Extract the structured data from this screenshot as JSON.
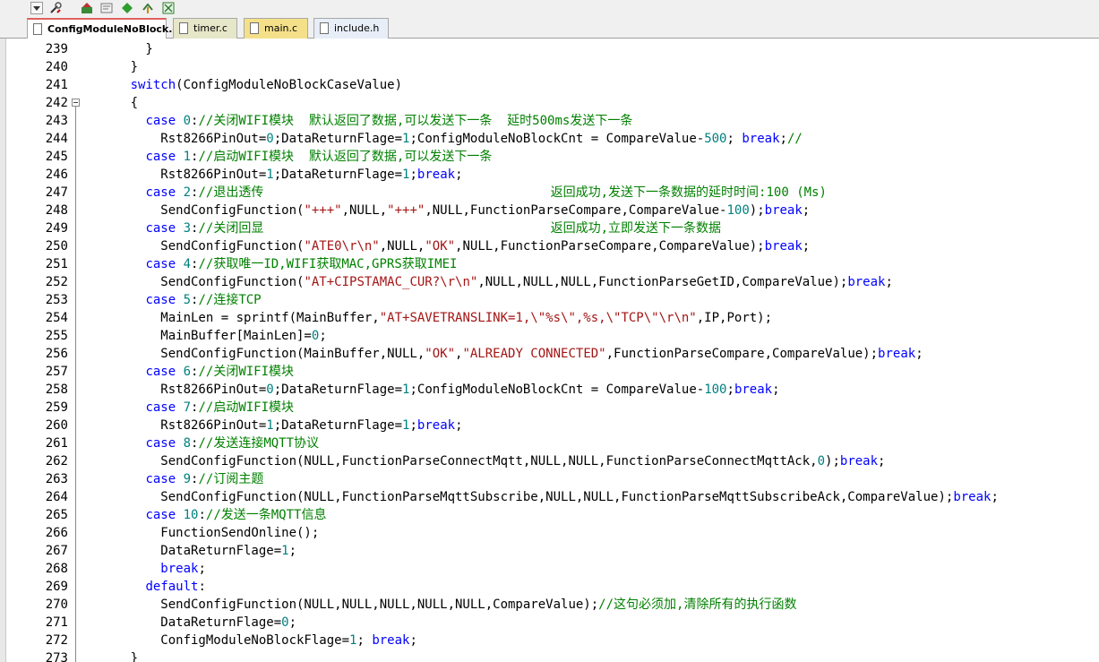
{
  "colors": {
    "keyword": "#0000ff",
    "comment": "#008000",
    "string": "#a31515",
    "number": "#008080",
    "active_tab": "#ffffff"
  },
  "toolbar": {
    "icons": [
      "dropdown-arrow-icon",
      "tools-icon",
      "load-icon",
      "translate-icon",
      "download-icon",
      "debug-icon",
      "build-icon"
    ]
  },
  "tabs": [
    {
      "label": "ConfigModuleNoBlock.c",
      "active": true
    },
    {
      "label": "timer.c",
      "active": false
    },
    {
      "label": "main.c",
      "active": false
    },
    {
      "label": "include.h",
      "active": false
    }
  ],
  "lines": [
    {
      "no": "239",
      "tokens": [
        [
          "p",
          "        }"
        ]
      ]
    },
    {
      "no": "240",
      "tokens": [
        [
          "p",
          "      }"
        ]
      ]
    },
    {
      "no": "241",
      "tokens": [
        [
          "p",
          "      "
        ],
        [
          "k",
          "switch"
        ],
        [
          "p",
          "(ConfigModuleNoBlockCaseValue)"
        ]
      ]
    },
    {
      "no": "242",
      "fold": true,
      "tokens": [
        [
          "p",
          "      {"
        ]
      ]
    },
    {
      "no": "243",
      "tokens": [
        [
          "p",
          "        "
        ],
        [
          "k",
          "case"
        ],
        [
          "p",
          " "
        ],
        [
          "n",
          "0"
        ],
        [
          "p",
          ":"
        ],
        [
          "c",
          "//关闭WIFI模块  默认返回了数据,可以发送下一条  延时500ms发送下一条"
        ]
      ]
    },
    {
      "no": "244",
      "tokens": [
        [
          "p",
          "          Rst8266PinOut="
        ],
        [
          "n",
          "0"
        ],
        [
          "p",
          ";DataReturnFlage="
        ],
        [
          "n",
          "1"
        ],
        [
          "p",
          ";ConfigModuleNoBlockCnt = CompareValue-"
        ],
        [
          "n",
          "500"
        ],
        [
          "p",
          "; "
        ],
        [
          "k",
          "break"
        ],
        [
          "p",
          ";"
        ],
        [
          "c",
          "//"
        ]
      ]
    },
    {
      "no": "245",
      "tokens": [
        [
          "p",
          "        "
        ],
        [
          "k",
          "case"
        ],
        [
          "p",
          " "
        ],
        [
          "n",
          "1"
        ],
        [
          "p",
          ":"
        ],
        [
          "c",
          "//启动WIFI模块  默认返回了数据,可以发送下一条"
        ]
      ]
    },
    {
      "no": "246",
      "tokens": [
        [
          "p",
          "          Rst8266PinOut="
        ],
        [
          "n",
          "1"
        ],
        [
          "p",
          ";DataReturnFlage="
        ],
        [
          "n",
          "1"
        ],
        [
          "p",
          ";"
        ],
        [
          "k",
          "break"
        ],
        [
          "p",
          ";"
        ]
      ]
    },
    {
      "no": "247",
      "tokens": [
        [
          "p",
          "        "
        ],
        [
          "k",
          "case"
        ],
        [
          "p",
          " "
        ],
        [
          "n",
          "2"
        ],
        [
          "p",
          ":"
        ],
        [
          "c",
          "//退出透传                                      返回成功,发送下一条数据的延时时间:100 (Ms)"
        ]
      ]
    },
    {
      "no": "248",
      "tokens": [
        [
          "p",
          "          SendConfigFunction("
        ],
        [
          "s",
          "\"+++\""
        ],
        [
          "p",
          ",NULL,"
        ],
        [
          "s",
          "\"+++\""
        ],
        [
          "p",
          ",NULL,FunctionParseCompare,CompareValue-"
        ],
        [
          "n",
          "100"
        ],
        [
          "p",
          ");"
        ],
        [
          "k",
          "break"
        ],
        [
          "p",
          ";"
        ]
      ]
    },
    {
      "no": "249",
      "tokens": [
        [
          "p",
          "        "
        ],
        [
          "k",
          "case"
        ],
        [
          "p",
          " "
        ],
        [
          "n",
          "3"
        ],
        [
          "p",
          ":"
        ],
        [
          "c",
          "//关闭回显                                      返回成功,立即发送下一条数据"
        ]
      ]
    },
    {
      "no": "250",
      "tokens": [
        [
          "p",
          "          SendConfigFunction("
        ],
        [
          "s",
          "\"ATE0\\r\\n\""
        ],
        [
          "p",
          ",NULL,"
        ],
        [
          "s",
          "\"OK\""
        ],
        [
          "p",
          ",NULL,FunctionParseCompare,CompareValue);"
        ],
        [
          "k",
          "break"
        ],
        [
          "p",
          ";"
        ]
      ]
    },
    {
      "no": "251",
      "tokens": [
        [
          "p",
          "        "
        ],
        [
          "k",
          "case"
        ],
        [
          "p",
          " "
        ],
        [
          "n",
          "4"
        ],
        [
          "p",
          ":"
        ],
        [
          "c",
          "//获取唯一ID,WIFI获取MAC,GPRS获取IMEI"
        ]
      ]
    },
    {
      "no": "252",
      "tokens": [
        [
          "p",
          "          SendConfigFunction("
        ],
        [
          "s",
          "\"AT+CIPSTAMAC_CUR?\\r\\n\""
        ],
        [
          "p",
          ",NULL,NULL,NULL,FunctionParseGetID,CompareValue);"
        ],
        [
          "k",
          "break"
        ],
        [
          "p",
          ";"
        ]
      ]
    },
    {
      "no": "253",
      "tokens": [
        [
          "p",
          "        "
        ],
        [
          "k",
          "case"
        ],
        [
          "p",
          " "
        ],
        [
          "n",
          "5"
        ],
        [
          "p",
          ":"
        ],
        [
          "c",
          "//连接TCP"
        ]
      ]
    },
    {
      "no": "254",
      "tokens": [
        [
          "p",
          "          MainLen = sprintf(MainBuffer,"
        ],
        [
          "s",
          "\"AT+SAVETRANSLINK=1,\\\"%s\\\",%s,\\\"TCP\\\"\\r\\n\""
        ],
        [
          "p",
          ",IP,Port);"
        ]
      ]
    },
    {
      "no": "255",
      "tokens": [
        [
          "p",
          "          MainBuffer[MainLen]="
        ],
        [
          "n",
          "0"
        ],
        [
          "p",
          ";"
        ]
      ]
    },
    {
      "no": "256",
      "tokens": [
        [
          "p",
          "          SendConfigFunction(MainBuffer,NULL,"
        ],
        [
          "s",
          "\"OK\""
        ],
        [
          "p",
          ","
        ],
        [
          "s",
          "\"ALREADY CONNECTED\""
        ],
        [
          "p",
          ",FunctionParseCompare,CompareValue);"
        ],
        [
          "k",
          "break"
        ],
        [
          "p",
          ";"
        ]
      ]
    },
    {
      "no": "257",
      "tokens": [
        [
          "p",
          "        "
        ],
        [
          "k",
          "case"
        ],
        [
          "p",
          " "
        ],
        [
          "n",
          "6"
        ],
        [
          "p",
          ":"
        ],
        [
          "c",
          "//关闭WIFI模块"
        ]
      ]
    },
    {
      "no": "258",
      "tokens": [
        [
          "p",
          "          Rst8266PinOut="
        ],
        [
          "n",
          "0"
        ],
        [
          "p",
          ";DataReturnFlage="
        ],
        [
          "n",
          "1"
        ],
        [
          "p",
          ";ConfigModuleNoBlockCnt = CompareValue-"
        ],
        [
          "n",
          "100"
        ],
        [
          "p",
          ";"
        ],
        [
          "k",
          "break"
        ],
        [
          "p",
          ";"
        ]
      ]
    },
    {
      "no": "259",
      "tokens": [
        [
          "p",
          "        "
        ],
        [
          "k",
          "case"
        ],
        [
          "p",
          " "
        ],
        [
          "n",
          "7"
        ],
        [
          "p",
          ":"
        ],
        [
          "c",
          "//启动WIFI模块"
        ]
      ]
    },
    {
      "no": "260",
      "tokens": [
        [
          "p",
          "          Rst8266PinOut="
        ],
        [
          "n",
          "1"
        ],
        [
          "p",
          ";DataReturnFlage="
        ],
        [
          "n",
          "1"
        ],
        [
          "p",
          ";"
        ],
        [
          "k",
          "break"
        ],
        [
          "p",
          ";"
        ]
      ]
    },
    {
      "no": "261",
      "tokens": [
        [
          "p",
          "        "
        ],
        [
          "k",
          "case"
        ],
        [
          "p",
          " "
        ],
        [
          "n",
          "8"
        ],
        [
          "p",
          ":"
        ],
        [
          "c",
          "//发送连接MQTT协议"
        ]
      ]
    },
    {
      "no": "262",
      "tokens": [
        [
          "p",
          "          SendConfigFunction(NULL,FunctionParseConnectMqtt,NULL,NULL,FunctionParseConnectMqttAck,"
        ],
        [
          "n",
          "0"
        ],
        [
          "p",
          ");"
        ],
        [
          "k",
          "break"
        ],
        [
          "p",
          ";"
        ]
      ]
    },
    {
      "no": "263",
      "tokens": [
        [
          "p",
          "        "
        ],
        [
          "k",
          "case"
        ],
        [
          "p",
          " "
        ],
        [
          "n",
          "9"
        ],
        [
          "p",
          ":"
        ],
        [
          "c",
          "//订阅主题"
        ]
      ]
    },
    {
      "no": "264",
      "tokens": [
        [
          "p",
          "          SendConfigFunction(NULL,FunctionParseMqttSubscribe,NULL,NULL,FunctionParseMqttSubscribeAck,CompareValue);"
        ],
        [
          "k",
          "break"
        ],
        [
          "p",
          ";"
        ]
      ]
    },
    {
      "no": "265",
      "tokens": [
        [
          "p",
          "        "
        ],
        [
          "k",
          "case"
        ],
        [
          "p",
          " "
        ],
        [
          "n",
          "10"
        ],
        [
          "p",
          ":"
        ],
        [
          "c",
          "//发送一条MQTT信息"
        ]
      ]
    },
    {
      "no": "266",
      "tokens": [
        [
          "p",
          "          FunctionSendOnline();"
        ]
      ]
    },
    {
      "no": "267",
      "tokens": [
        [
          "p",
          "          DataReturnFlage="
        ],
        [
          "n",
          "1"
        ],
        [
          "p",
          ";"
        ]
      ]
    },
    {
      "no": "268",
      "tokens": [
        [
          "p",
          "          "
        ],
        [
          "k",
          "break"
        ],
        [
          "p",
          ";"
        ]
      ]
    },
    {
      "no": "269",
      "tokens": [
        [
          "p",
          "        "
        ],
        [
          "k",
          "default"
        ],
        [
          "p",
          ":"
        ]
      ]
    },
    {
      "no": "270",
      "tokens": [
        [
          "p",
          "          SendConfigFunction(NULL,NULL,NULL,NULL,NULL,CompareValue);"
        ],
        [
          "c",
          "//这句必须加,清除所有的执行函数"
        ]
      ]
    },
    {
      "no": "271",
      "tokens": [
        [
          "p",
          "          DataReturnFlage="
        ],
        [
          "n",
          "0"
        ],
        [
          "p",
          ";"
        ]
      ]
    },
    {
      "no": "272",
      "tokens": [
        [
          "p",
          "          ConfigModuleNoBlockFlage="
        ],
        [
          "n",
          "1"
        ],
        [
          "p",
          "; "
        ],
        [
          "k",
          "break"
        ],
        [
          "p",
          ";"
        ]
      ]
    },
    {
      "no": "273",
      "tokens": [
        [
          "p",
          "      }"
        ]
      ]
    }
  ]
}
